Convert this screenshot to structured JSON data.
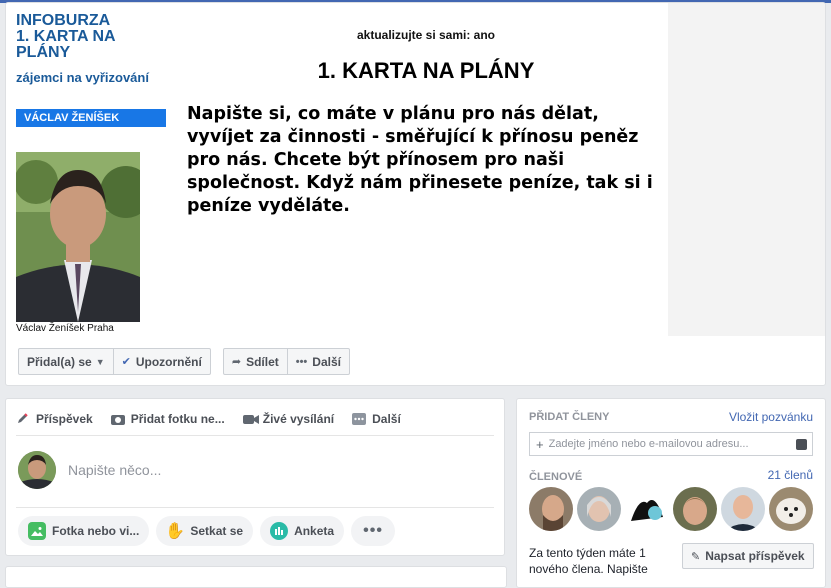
{
  "cover": {
    "left_title": "INFOBURZA\n1. KARTA NA PLÁNY",
    "left_subtitle": "zájemci na vyřizování",
    "name_bar": "VÁCLAV ŽENÍŠEK",
    "photo_caption": "Václav Ženíšek Praha",
    "doc_top": "aktualizujte si sami: ano",
    "doc_heading": "1. KARTA NA PLÁNY",
    "doc_paragraph": "Napište si, co máte v plánu pro nás dělat, vyvíjet za činnosti - směřující k přínosu peněz pro nás. Chcete být přínosem pro naši společnost. Když nám přinesete peníze, tak si i peníze vyděláte."
  },
  "actions": {
    "joined": "Přidal(a) se",
    "notifications": "Upozornění",
    "share": "Sdílet",
    "more": "Další"
  },
  "composer": {
    "tabs": [
      "Příspěvek",
      "Přidat fotku ne...",
      "Živé vysílání",
      "Další"
    ],
    "placeholder": "Napište něco...",
    "pills": [
      "Fotka nebo vi...",
      "Setkat se",
      "Anketa"
    ]
  },
  "members": {
    "add_header": "PŘIDAT ČLENY",
    "invite_link": "Vložit pozvánku",
    "input_placeholder": "Zadejte jméno nebo e-mailovou adresu...",
    "members_header": "ČLENOVÉ",
    "members_count": "21 členů",
    "week_text": "Za tento týden máte 1 nového člena. Napište",
    "write_post": "Napsat příspěvek"
  },
  "colors": {
    "brand_blue": "#4267b2",
    "cover_blue": "#1877e6",
    "cover_text_blue": "#1a5a99"
  }
}
